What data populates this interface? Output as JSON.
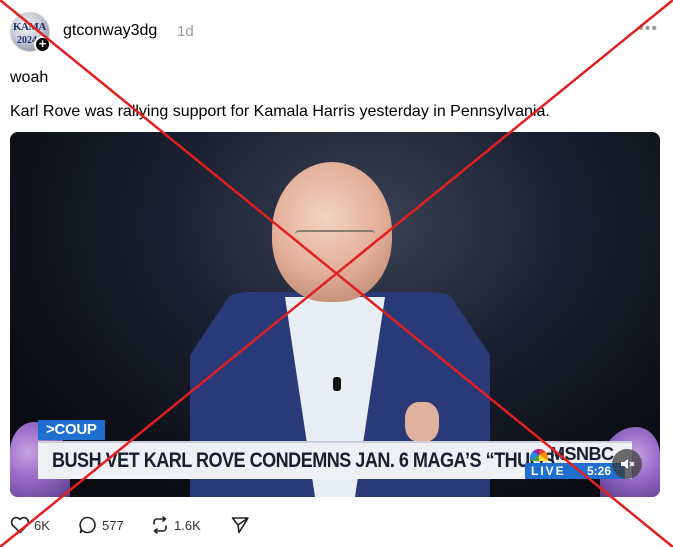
{
  "post": {
    "username": "gtconway3dg",
    "timestamp": "1d",
    "avatar_text_top": "KAMA",
    "avatar_text_bottom": "2024",
    "text_line1": "woah",
    "text_line2": "Karl Rove was rallying support for Kamala Harris yesterday in Pennsylvania."
  },
  "video": {
    "chyron_tag": ">COUP",
    "chyron_headline": "BUSH VET KARL ROVE CONDEMNS JAN. 6 MAGA’S “THUGS”",
    "network": "MSNBC",
    "live_label": "LIVE",
    "time": "5:26"
  },
  "actions": {
    "likes": "6K",
    "replies": "577",
    "reposts": "1.6K"
  },
  "icons": {
    "more": "more-horizontal-icon",
    "like": "heart-icon",
    "reply": "comment-icon",
    "repost": "repost-icon",
    "share": "send-icon",
    "mute": "muted-speaker-icon",
    "follow": "plus-icon"
  },
  "colors": {
    "overlay_x": "#e02020",
    "chyron_blue": "#1f6fd0",
    "suit_blue": "#2a3a78"
  }
}
